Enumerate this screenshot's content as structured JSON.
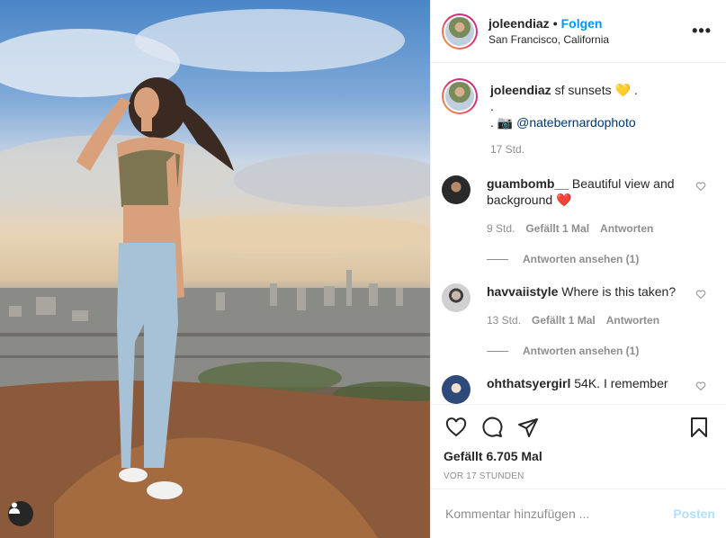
{
  "post": {
    "username": "joleendiaz",
    "follow_label": "Folgen",
    "separator": "•",
    "location": "San Francisco, California",
    "more_label": "•••"
  },
  "caption": {
    "username": "joleendiaz",
    "text": "sf sunsets",
    "emoji": "💛",
    "trail": ".",
    "line2": ".",
    "line3_prefix": ".",
    "camera_emoji": "📷",
    "mention": "@natebernardophoto",
    "time": "17 Std."
  },
  "comments": [
    {
      "username": "guambomb__",
      "text": "Beautiful view and background",
      "emoji": "❤️",
      "time": "9 Std.",
      "likes": "Gefällt 1 Mal",
      "reply": "Antworten",
      "view_replies": "Antworten ansehen (1)",
      "avatar_color": "#3b3b3b"
    },
    {
      "username": "havvaiistyle",
      "text": "Where is this taken?",
      "emoji": "",
      "time": "13 Std.",
      "likes": "Gefällt 1 Mal",
      "reply": "Antworten",
      "view_replies": "Antworten ansehen (1)",
      "avatar_color": "#8a8a8a"
    },
    {
      "username": "ohthatsyergirl",
      "text": "54K. I remember",
      "emoji": "",
      "avatar_color": "#2d4a7a"
    }
  ],
  "actions": {
    "likes_text": "Gefällt 6.705 Mal",
    "posted": "VOR 17 STUNDEN"
  },
  "add_comment": {
    "placeholder": "Kommentar hinzufügen ...",
    "post_label": "Posten"
  },
  "icons": {
    "like": "heart-outline-icon",
    "comment": "speech-bubble-icon",
    "share": "paper-plane-icon",
    "save": "bookmark-icon",
    "user_tag": "user-silhouette-icon",
    "comment_like": "small-heart-icon"
  },
  "colors": {
    "follow_blue": "#0095f6",
    "post_disabled": "#b2dffc",
    "meta_gray": "#8e8e8e",
    "mention_blue": "#00376b",
    "heart_red": "#ed4956"
  }
}
